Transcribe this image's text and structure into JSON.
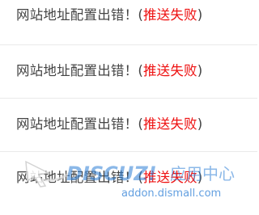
{
  "list": {
    "items": [
      {
        "message": "网站地址配置出错！",
        "paren_open": "(",
        "status": "推送失败",
        "paren_close": ")"
      },
      {
        "message": "网站地址配置出错！",
        "paren_open": "(",
        "status": "推送失败",
        "paren_close": ")"
      },
      {
        "message": "网站地址配置出错！",
        "paren_open": "(",
        "status": "推送失败",
        "paren_close": ")"
      },
      {
        "message": "网站地址配置出错！",
        "paren_open": "(",
        "status": "推送失败",
        "paren_close": ")"
      }
    ]
  },
  "watermark": {
    "brand": "DISCUZ!",
    "subtitle": "应用中心",
    "url": "addon.dismall.com"
  },
  "colors": {
    "text": "#444444",
    "status_fail": "#ee1111",
    "divider": "#eaeaea",
    "watermark_blue": "#2e7fd6"
  }
}
